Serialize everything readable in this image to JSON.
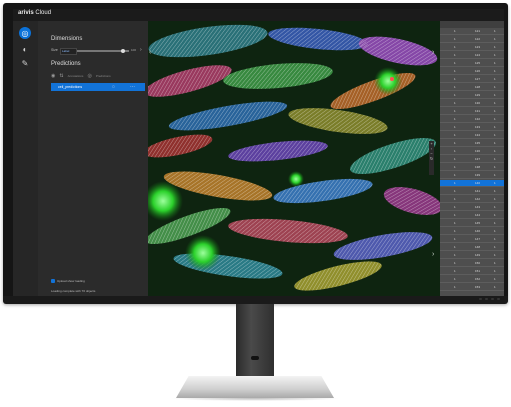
{
  "app": {
    "logo_bold": "arivis",
    "logo_rest": " Cloud"
  },
  "sidebar_icons": [
    {
      "icon": "layers-icon",
      "glyph": "◎",
      "active": true
    },
    {
      "icon": "palette-icon",
      "glyph": "◐",
      "active": false
    },
    {
      "icon": "annotate-icon",
      "glyph": "✎",
      "active": false
    }
  ],
  "dimensions": {
    "heading": "Dimensions",
    "size_label": "Size",
    "size_value": "Label",
    "size_readout": "100"
  },
  "predictions": {
    "heading": "Predictions",
    "tools": [
      "Annotations",
      "Predictions"
    ],
    "selected_item": "cell_predictions"
  },
  "footer": {
    "checkbox_label": "Upload show loading",
    "status": "Loading complete with 70 objects"
  },
  "table": {
    "rows": [
      {
        "c1": "1",
        "c2": "121",
        "c3": "1"
      },
      {
        "c1": "1",
        "c2": "122",
        "c3": "1"
      },
      {
        "c1": "1",
        "c2": "123",
        "c3": "1"
      },
      {
        "c1": "1",
        "c2": "124",
        "c3": "1"
      },
      {
        "c1": "1",
        "c2": "125",
        "c3": "1"
      },
      {
        "c1": "1",
        "c2": "126",
        "c3": "1"
      },
      {
        "c1": "1",
        "c2": "127",
        "c3": "1"
      },
      {
        "c1": "1",
        "c2": "128",
        "c3": "1"
      },
      {
        "c1": "1",
        "c2": "129",
        "c3": "1"
      },
      {
        "c1": "1",
        "c2": "130",
        "c3": "1"
      },
      {
        "c1": "1",
        "c2": "131",
        "c3": "1"
      },
      {
        "c1": "1",
        "c2": "132",
        "c3": "1"
      },
      {
        "c1": "1",
        "c2": "133",
        "c3": "1"
      },
      {
        "c1": "1",
        "c2": "134",
        "c3": "1"
      },
      {
        "c1": "1",
        "c2": "135",
        "c3": "1"
      },
      {
        "c1": "1",
        "c2": "136",
        "c3": "1"
      },
      {
        "c1": "1",
        "c2": "137",
        "c3": "1"
      },
      {
        "c1": "1",
        "c2": "138",
        "c3": "1"
      },
      {
        "c1": "1",
        "c2": "139",
        "c3": "1"
      },
      {
        "c1": "1",
        "c2": "140",
        "c3": "1"
      },
      {
        "c1": "1",
        "c2": "141",
        "c3": "1"
      },
      {
        "c1": "1",
        "c2": "142",
        "c3": "1"
      },
      {
        "c1": "1",
        "c2": "143",
        "c3": "1"
      },
      {
        "c1": "1",
        "c2": "144",
        "c3": "1"
      },
      {
        "c1": "1",
        "c2": "145",
        "c3": "1"
      },
      {
        "c1": "1",
        "c2": "146",
        "c3": "1"
      },
      {
        "c1": "1",
        "c2": "147",
        "c3": "1"
      },
      {
        "c1": "1",
        "c2": "148",
        "c3": "1"
      },
      {
        "c1": "1",
        "c2": "149",
        "c3": "1"
      },
      {
        "c1": "1",
        "c2": "150",
        "c3": "1"
      },
      {
        "c1": "1",
        "c2": "151",
        "c3": "1"
      },
      {
        "c1": "1",
        "c2": "152",
        "c3": "1"
      },
      {
        "c1": "1",
        "c2": "153",
        "c3": "1"
      }
    ],
    "selected_index": 19
  },
  "colors": {
    "accent": "#1273d8",
    "panel": "#2b2b2b",
    "table_bg": "#4e4e4e"
  }
}
